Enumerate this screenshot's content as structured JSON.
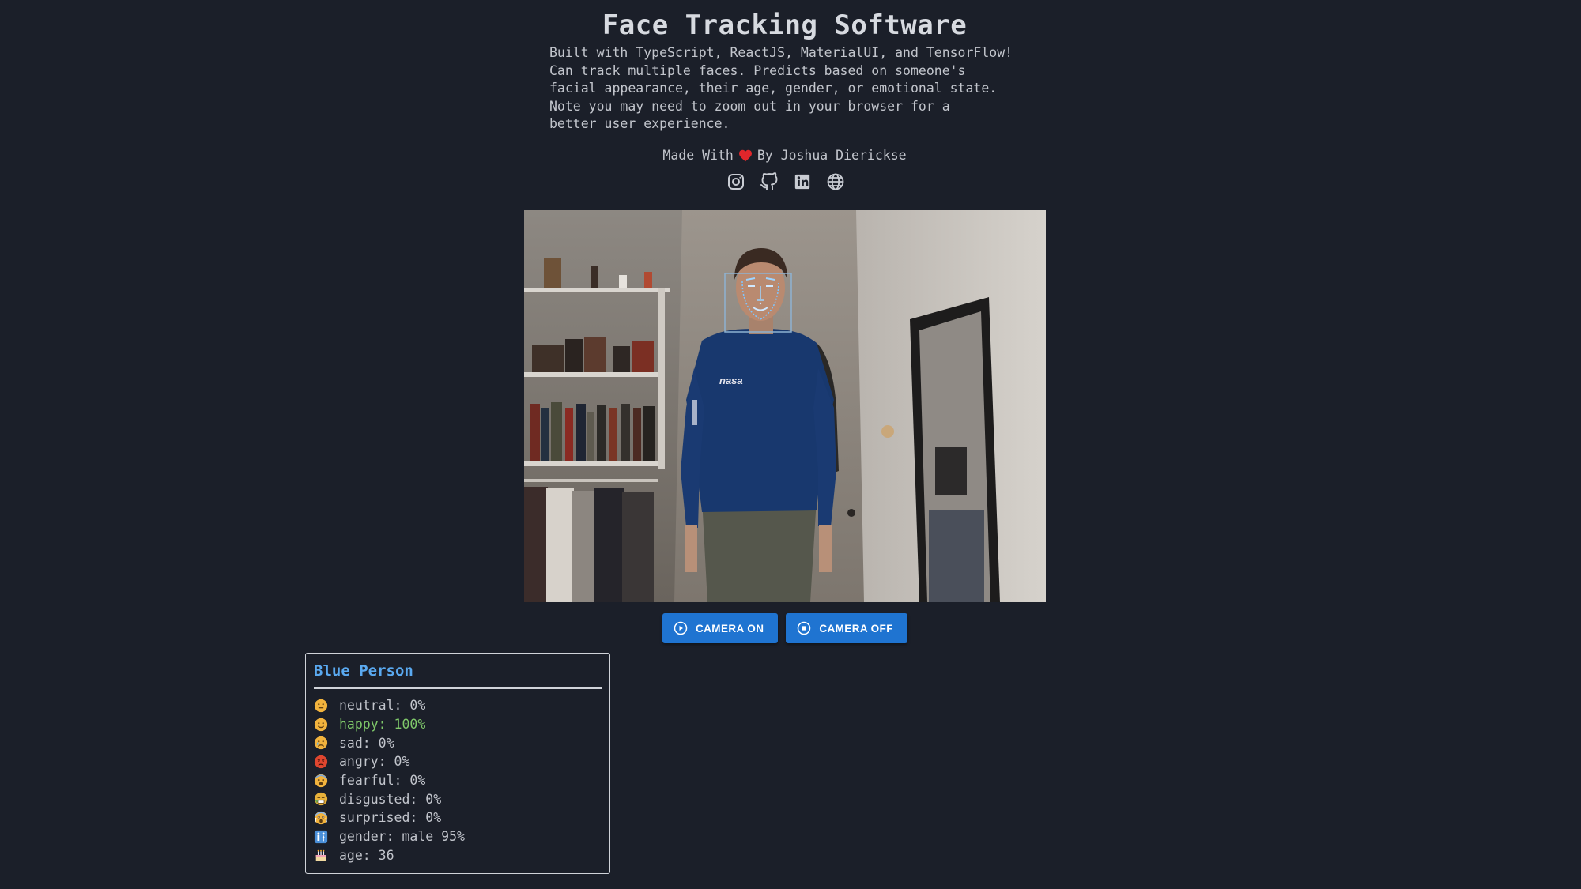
{
  "header": {
    "title": "Face Tracking Software",
    "description_lines": [
      "Built with TypeScript, ReactJS, MaterialUI, and TensorFlow!",
      "Can track multiple faces. Predicts based on someone's",
      "facial appearance, their age, gender, or emotional state.",
      "Note you may need to zoom out in your browser for a",
      "better user experience."
    ],
    "made_with_prefix": "Made With",
    "made_with_suffix": "By Joshua Dierickse"
  },
  "socials": [
    "instagram-icon",
    "github-icon",
    "linkedin-icon",
    "globe-icon"
  ],
  "video": {
    "shirt_text": "nasa"
  },
  "controls": {
    "camera_on_label": "CAMERA ON",
    "camera_off_label": "CAMERA OFF"
  },
  "panel": {
    "title": "Blue Person",
    "stats": [
      {
        "icon": "neutral-face-icon",
        "text": "neutral: 0%"
      },
      {
        "icon": "happy-face-icon",
        "text": "happy: 100%",
        "highlight": true
      },
      {
        "icon": "sad-face-icon",
        "text": "sad: 0%"
      },
      {
        "icon": "angry-face-icon",
        "text": "angry: 0%"
      },
      {
        "icon": "fearful-face-icon",
        "text": "fearful: 0%"
      },
      {
        "icon": "disgusted-face-icon",
        "text": "disgusted: 0%"
      },
      {
        "icon": "surprised-face-icon",
        "text": "surprised: 0%"
      },
      {
        "icon": "gender-icon",
        "text": "gender: male 95%"
      },
      {
        "icon": "cake-icon",
        "text": "age: 36"
      }
    ]
  },
  "colors": {
    "background": "#1b1f29",
    "accent": "#1f74d1",
    "panel_title": "#5aa9f0",
    "highlight": "#7fc86a",
    "heart": "#e0262b"
  }
}
